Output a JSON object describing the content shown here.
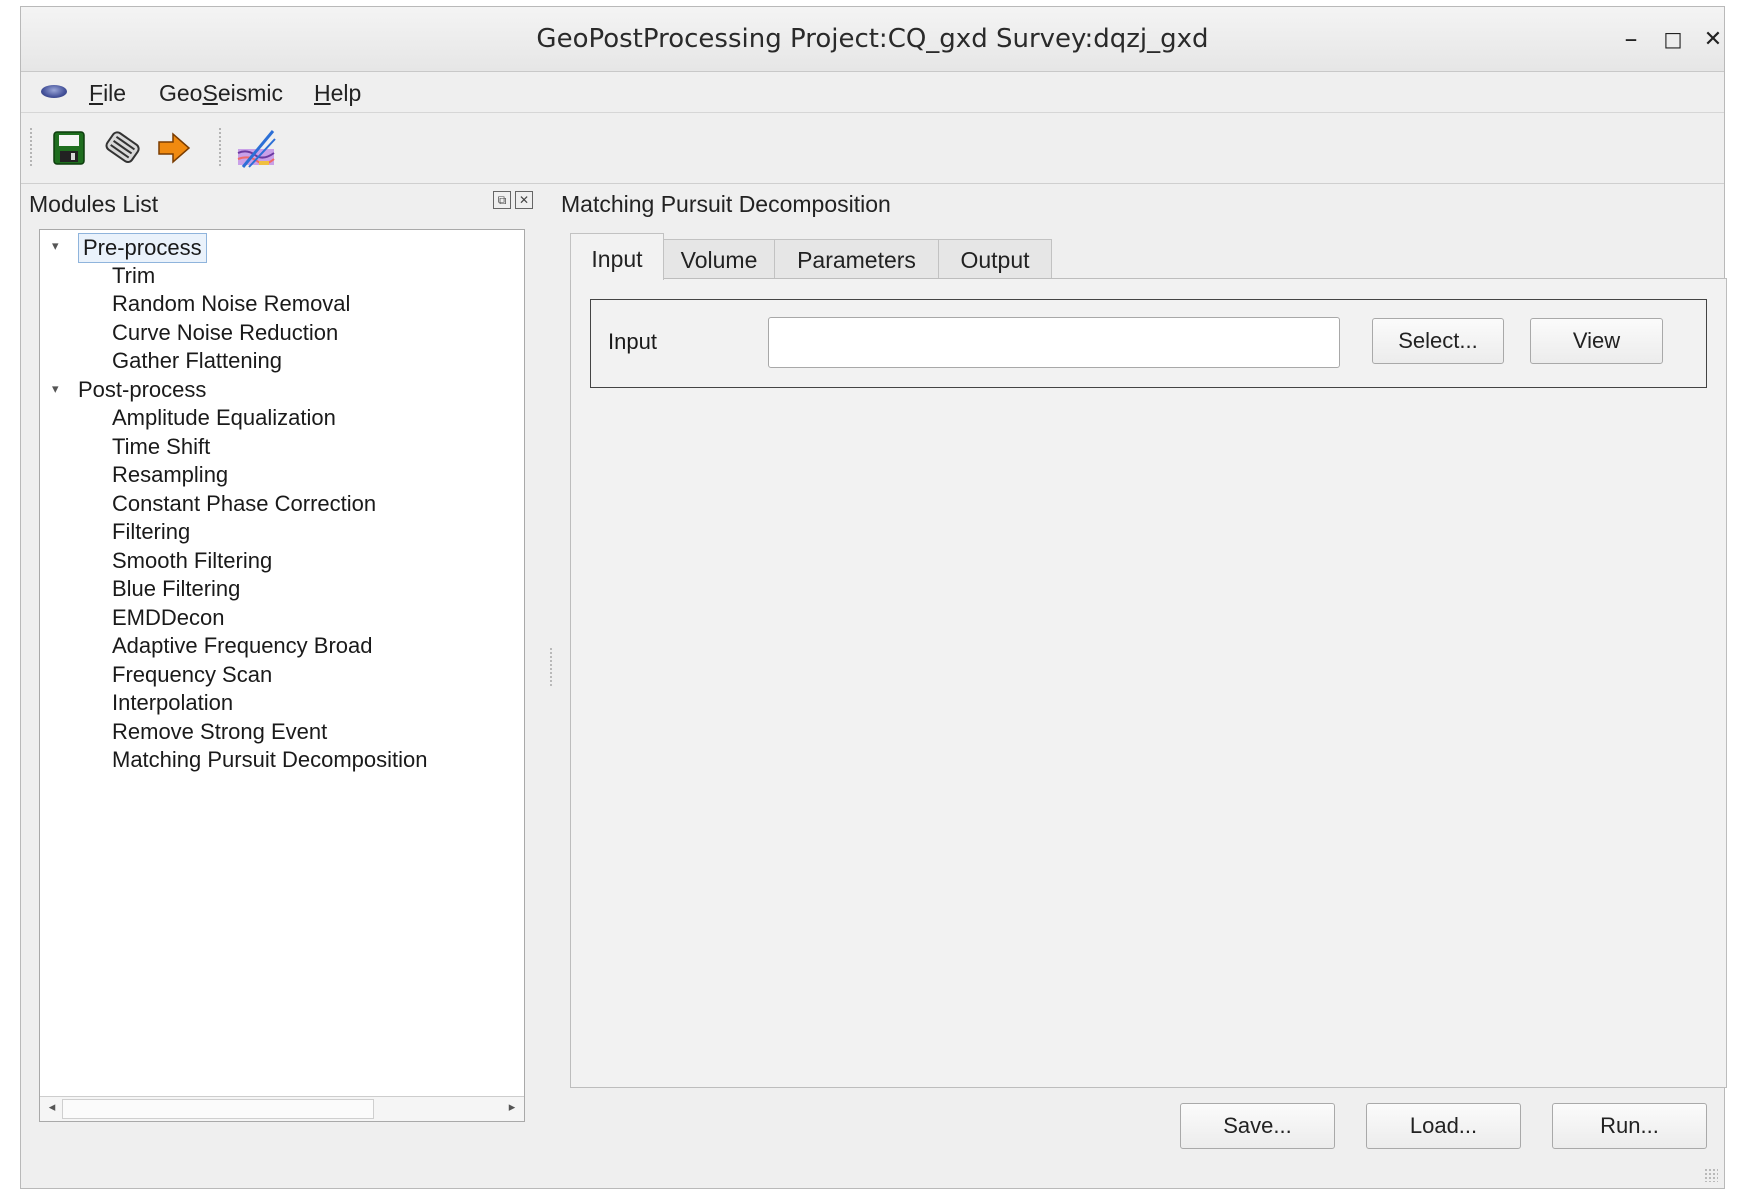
{
  "window": {
    "title": "GeoPostProcessing Project:CQ_gxd   Survey:dqzj_gxd",
    "controls": {
      "minimize": "–",
      "maximize": "□",
      "close": "✕"
    }
  },
  "menubar": {
    "file_prefix": "",
    "file_ul": "F",
    "file_rest": "ile",
    "geo_prefix": "Geo",
    "geo_ul": "S",
    "geo_rest": "eismic",
    "help_prefix": "",
    "help_ul": "H",
    "help_rest": "elp"
  },
  "toolbar": {
    "buttons": [
      {
        "icon": "save-icon"
      },
      {
        "icon": "clean-icon"
      },
      {
        "icon": "arrow-right-icon"
      },
      {
        "icon": "seismic-view-icon"
      }
    ],
    "colors": {
      "save": "#1f6e1f",
      "arrow": "#f08a10",
      "seismic": "#8a5ac0"
    }
  },
  "dock": {
    "title": "Modules List",
    "float_btn": "⧉",
    "close_btn": "✕",
    "tree": [
      {
        "label": "Pre-process",
        "level": 0,
        "expanded": true,
        "selected": true
      },
      {
        "label": "Trim",
        "level": 1
      },
      {
        "label": "Random Noise Removal",
        "level": 1
      },
      {
        "label": "Curve Noise Reduction",
        "level": 1
      },
      {
        "label": "Gather Flattening",
        "level": 1
      },
      {
        "label": "Post-process",
        "level": 0,
        "expanded": true
      },
      {
        "label": "Amplitude Equalization",
        "level": 1
      },
      {
        "label": "Time Shift",
        "level": 1
      },
      {
        "label": "Resampling",
        "level": 1
      },
      {
        "label": "Constant Phase Correction",
        "level": 1
      },
      {
        "label": "Filtering",
        "level": 1
      },
      {
        "label": "Smooth Filtering",
        "level": 1
      },
      {
        "label": "Blue Filtering",
        "level": 1
      },
      {
        "label": "EMDDecon",
        "level": 1
      },
      {
        "label": "Adaptive Frequency Broad",
        "level": 1
      },
      {
        "label": "Frequency Scan",
        "level": 1
      },
      {
        "label": "Interpolation",
        "level": 1
      },
      {
        "label": "Remove Strong Event",
        "level": 1
      },
      {
        "label": "Matching Pursuit Decomposition",
        "level": 1
      }
    ],
    "scroll": {
      "left": "◂",
      "right": "▸"
    }
  },
  "main": {
    "title": "Matching Pursuit Decomposition",
    "tabs": [
      "Input",
      "Volume",
      "Parameters",
      "Output"
    ],
    "active_tab": "Input",
    "input_group": {
      "label": "Input",
      "value": "",
      "select_button": "Select...",
      "view_button": "View"
    },
    "footer": {
      "save": "Save...",
      "load": "Load...",
      "run": "Run..."
    }
  }
}
